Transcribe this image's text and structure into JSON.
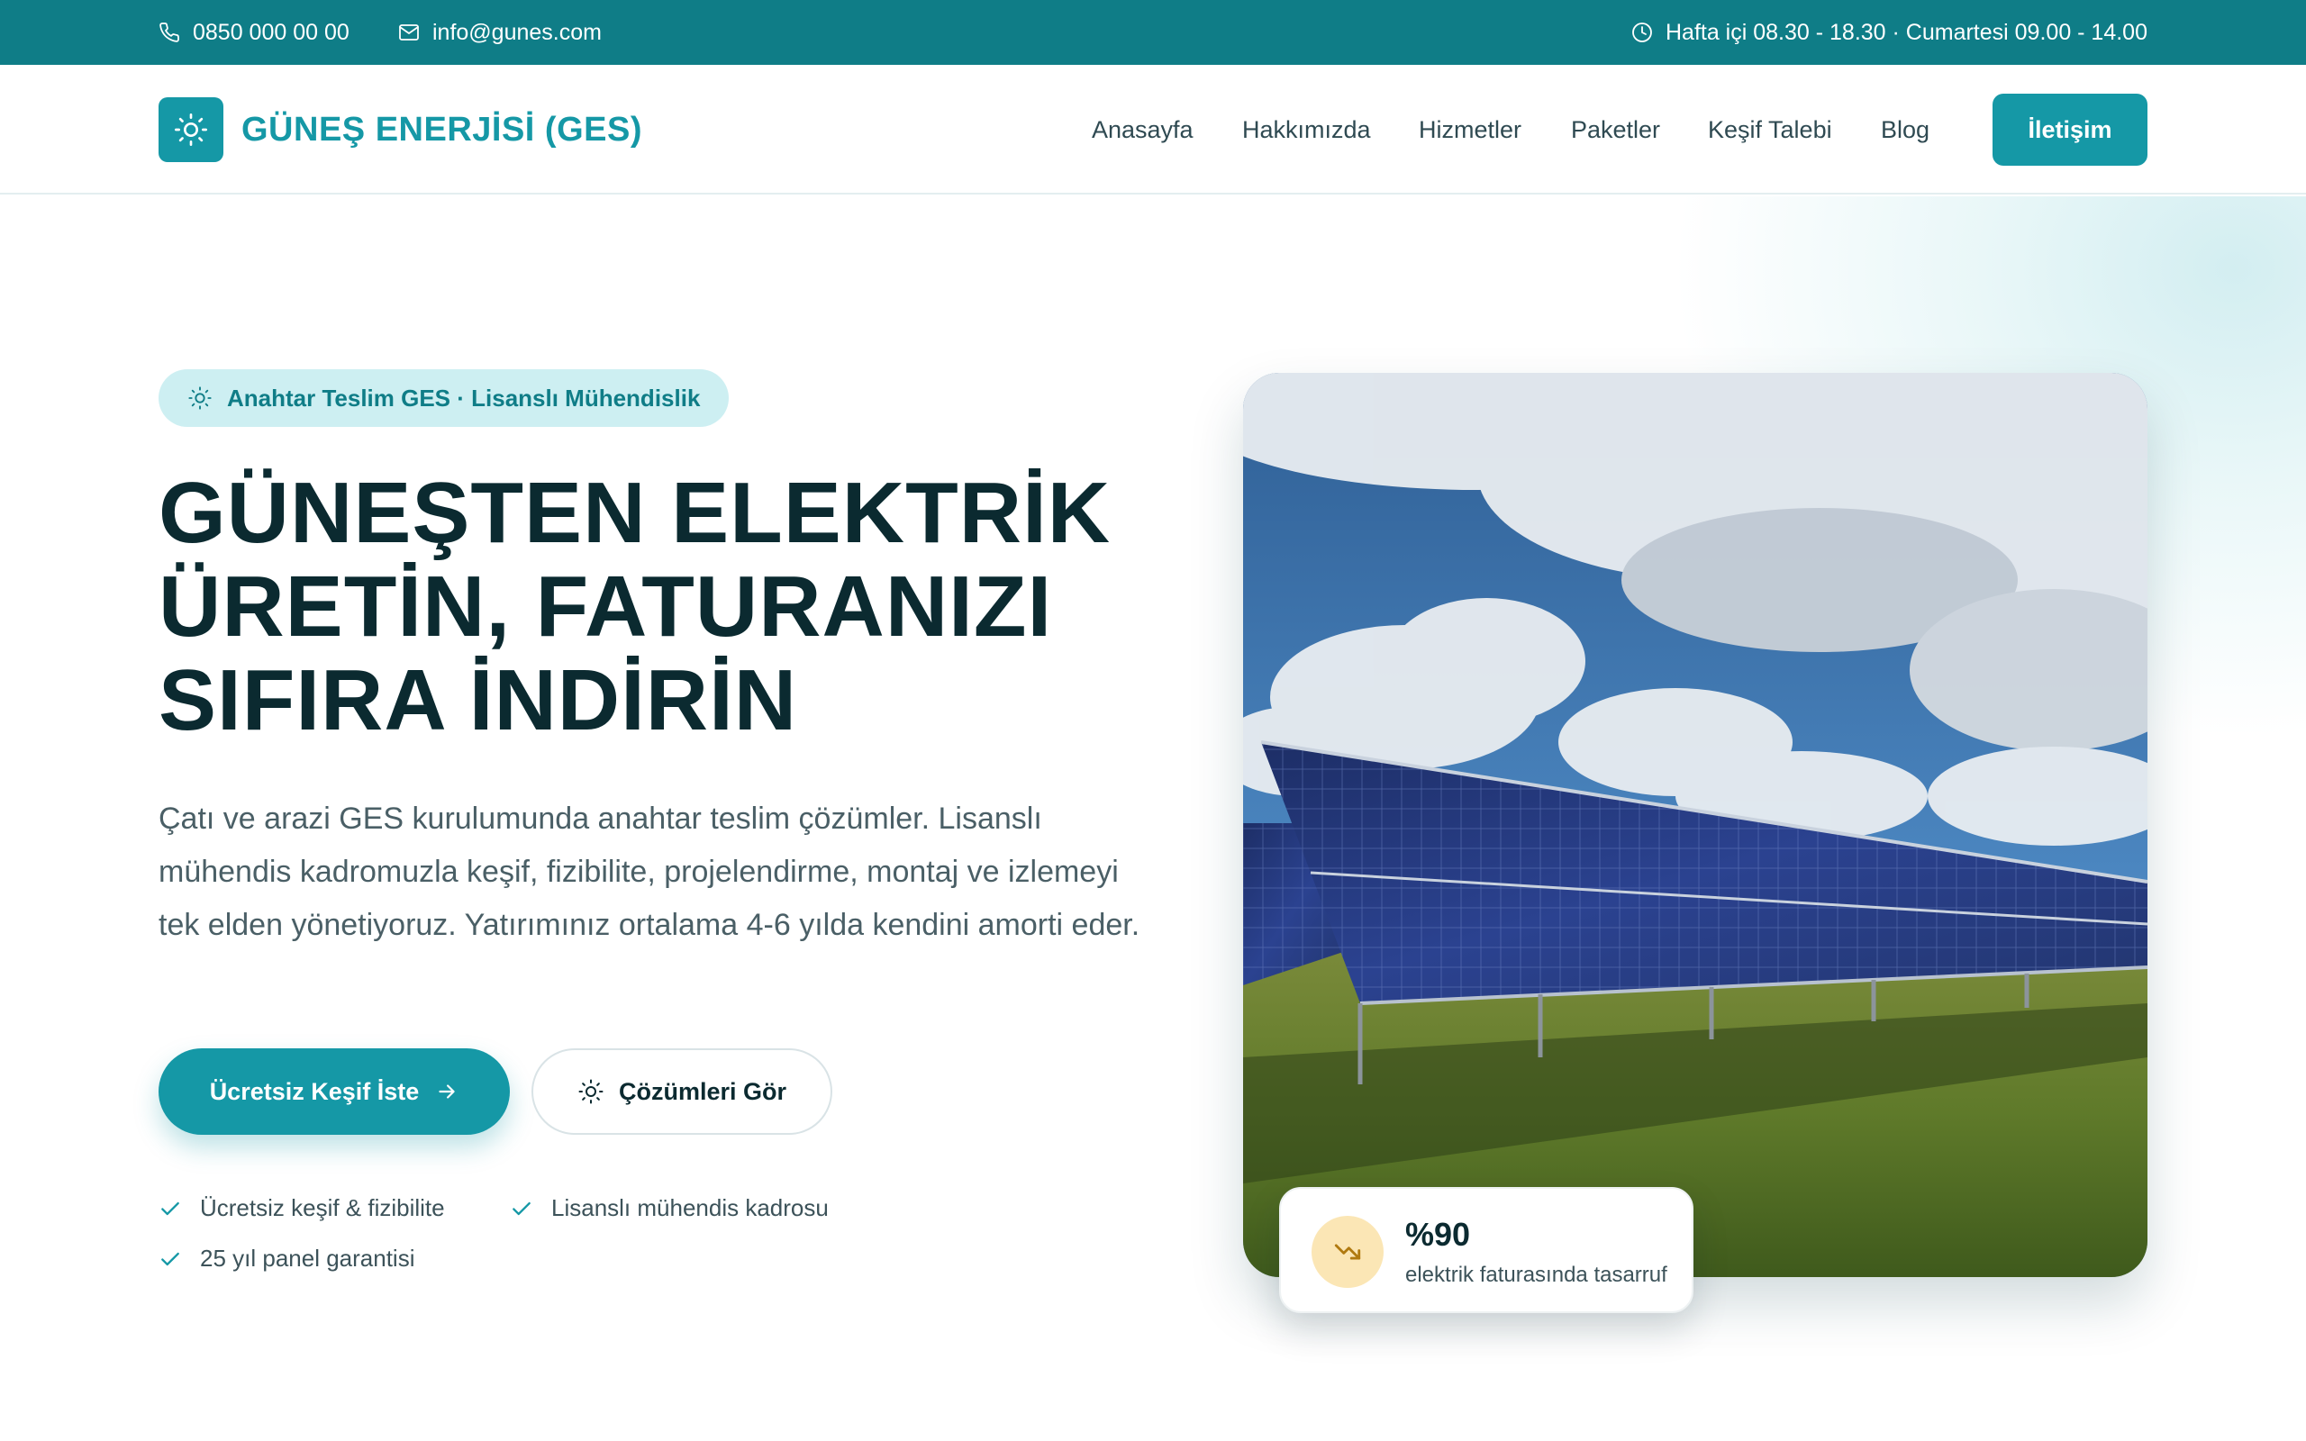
{
  "topbar": {
    "phone": "0850 000 00 00",
    "email": "info@gunes.com",
    "hours": "Hafta içi 08.30 - 18.30 · Cumartesi 09.00 - 14.00"
  },
  "header": {
    "logo_text": "GÜNEŞ ENERJİSİ (GES)",
    "nav": [
      "Anasayfa",
      "Hakkımızda",
      "Hizmetler",
      "Paketler",
      "Keşif Talebi",
      "Blog"
    ],
    "cta": "İletişim"
  },
  "hero": {
    "badge": "Anahtar Teslim GES · Lisanslı Mühendislik",
    "headline_lines": [
      "GÜNEŞTEN ELEKTRİK",
      "ÜRETİN, FATURANIZI",
      "SIFIRA İNDİRİN"
    ],
    "lead": "Çatı ve arazi GES kurulumunda anahtar teslim çözümler. Lisanslı mühendis kadromuzla keşif, fizibilite, projelendirme, montaj ve izlemeyi tek elden yönetiyoruz. Yatırımınız ortalama 4-6 yılda kendini amorti eder.",
    "primary_button": "Ücretsiz Keşif İste",
    "secondary_button": "Çözümleri Gör",
    "checks": [
      "Ücretsiz keşif & fizibilite",
      "Lisanslı mühendis kadrosu",
      "25 yıl panel garantisi"
    ]
  },
  "stat": {
    "value": "%90",
    "label": "elektrik faturasında tasarruf"
  },
  "icons": {
    "phone": "phone-icon",
    "mail": "mail-icon",
    "clock": "clock-icon",
    "logo": "sun-icon",
    "arrow": "arrow-right-icon",
    "check": "check-icon",
    "trend": "trending-down-icon"
  },
  "colors": {
    "brand": "#1598a6",
    "topbar": "#0f7d87",
    "badge_bg": "#cdeff2",
    "heading": "#0b2a30",
    "stat_icon_bg": "#fbe6b5"
  }
}
